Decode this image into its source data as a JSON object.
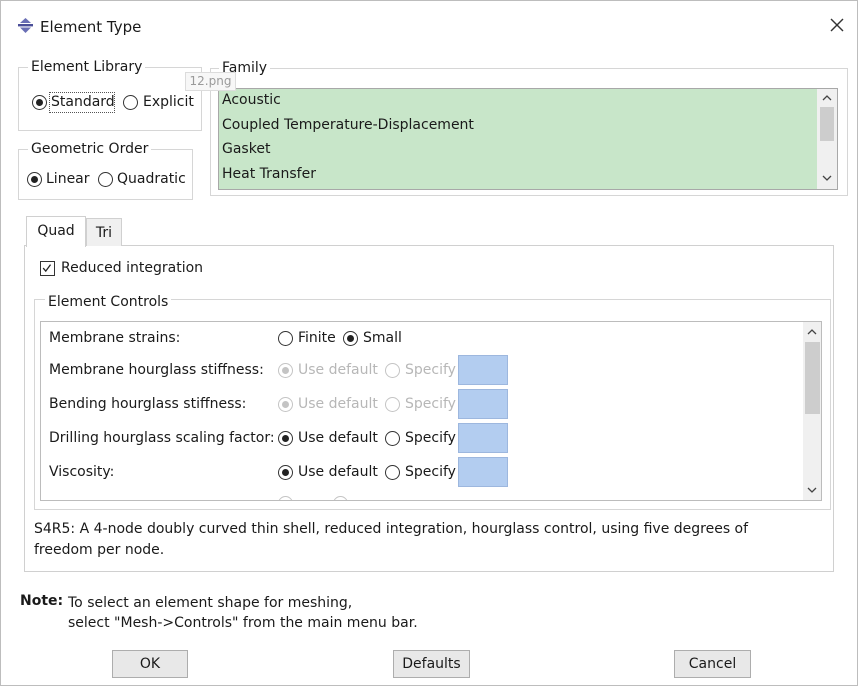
{
  "window": {
    "title": "Element Type"
  },
  "tooltip": {
    "text": "12.png"
  },
  "element_library": {
    "title": "Element Library",
    "options": [
      {
        "label": "Standard",
        "selected": true
      },
      {
        "label": "Explicit",
        "selected": false
      }
    ]
  },
  "geometric_order": {
    "title": "Geometric Order",
    "options": [
      {
        "label": "Linear",
        "selected": true
      },
      {
        "label": "Quadratic",
        "selected": false
      }
    ]
  },
  "family": {
    "title": "Family",
    "list_color": "#c8e6c9",
    "items": [
      "Acoustic",
      "Coupled Temperature-Displacement",
      "Gasket",
      "Heat Transfer"
    ]
  },
  "tabs": [
    {
      "label": "Quad",
      "active": true
    },
    {
      "label": "Tri",
      "active": false
    }
  ],
  "reduced_integration": {
    "label": "Reduced integration",
    "checked": true
  },
  "element_controls": {
    "title": "Element Controls",
    "rows": [
      {
        "label": "Membrane strains:",
        "opt1": "Finite",
        "opt2": "Small",
        "selected": "opt2",
        "enabled": true
      },
      {
        "label": "Membrane hourglass stiffness:",
        "opt1": "Use default",
        "opt2": "Specify",
        "selected": "opt1",
        "enabled": false
      },
      {
        "label": "Bending hourglass stiffness:",
        "opt1": "Use default",
        "opt2": "Specify",
        "selected": "opt1",
        "enabled": false
      },
      {
        "label": "Drilling hourglass scaling factor:",
        "opt1": "Use default",
        "opt2": "Specify",
        "selected": "opt1",
        "enabled": true
      },
      {
        "label": "Viscosity:",
        "opt1": "Use default",
        "opt2": "Specify",
        "selected": "opt1",
        "enabled": true
      }
    ],
    "specify_color": "#b3cdf0"
  },
  "description": {
    "line1": "S4R5:  A 4-node doubly curved thin shell, reduced integration, hourglass control, using five degrees of",
    "line2": "freedom per node."
  },
  "note": {
    "label": "Note:",
    "line1": "To select an element shape for meshing,",
    "line2": "select \"Mesh->Controls\" from the main menu bar."
  },
  "buttons": {
    "ok": "OK",
    "defaults": "Defaults",
    "cancel": "Cancel"
  }
}
